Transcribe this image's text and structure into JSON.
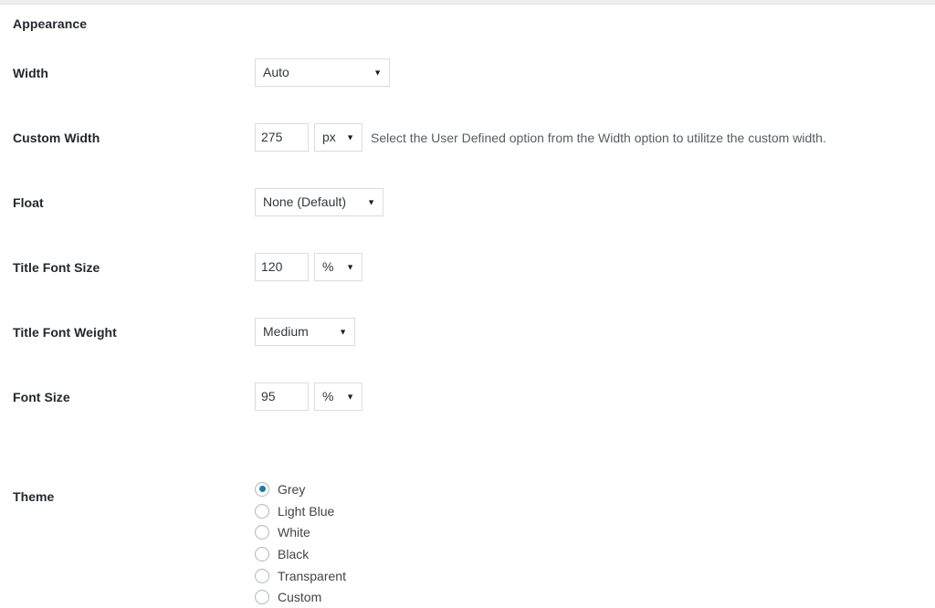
{
  "section": {
    "title": "Appearance"
  },
  "rows": [
    {
      "label": "Width",
      "control": "select",
      "value": "Auto"
    },
    {
      "label": "Custom Width",
      "control": "input-unit",
      "value": "275",
      "unit": "px",
      "description": "Select the User Defined option from the Width option to utilitze the custom width."
    },
    {
      "label": "Float",
      "control": "select",
      "value": "None (Default)"
    },
    {
      "label": "Title Font Size",
      "control": "input-unit",
      "value": "120",
      "unit": "%"
    },
    {
      "label": "Title Font Weight",
      "control": "select",
      "value": "Medium"
    },
    {
      "label": "Font Size",
      "control": "input-unit",
      "value": "95",
      "unit": "%"
    }
  ],
  "theme": {
    "label": "Theme",
    "selected": "Grey",
    "options": [
      "Grey",
      "Light Blue",
      "White",
      "Black",
      "Transparent",
      "Custom"
    ]
  },
  "icons": {
    "caret": "▼"
  },
  "colors": {
    "accent": "#1b7bab",
    "label_text": "#23282d",
    "body_text": "#32373c",
    "muted_text": "#555d66",
    "border": "#dddddd",
    "top_strip": "#eeeeee"
  }
}
